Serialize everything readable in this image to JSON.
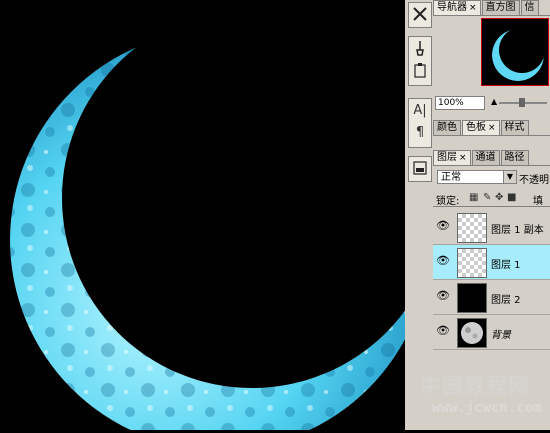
{
  "colors": {
    "canvas_bg": "#000000",
    "moon_light": "#a9f2ff",
    "moon_mid": "#3ac3ea",
    "moon_dark": "#0b6c9a",
    "panel_bg": "#d4d0c8",
    "selected_layer": "#a6ecfb"
  },
  "toolbar": {
    "tools": [
      {
        "icon": "crossed-tools-icon"
      },
      {
        "icon": "brush-presets-icon"
      },
      {
        "icon": "clipboard-icon"
      },
      {
        "icon": "character-icon",
        "glyph": "A|"
      },
      {
        "icon": "paragraph-icon",
        "glyph": "¶"
      },
      {
        "icon": "layer-comps-icon"
      }
    ]
  },
  "panels": {
    "navigator": {
      "tabs": [
        {
          "label": "导航器",
          "close": "×",
          "active": true
        },
        {
          "label": "直方图",
          "active": false
        },
        {
          "label": "信",
          "active": false
        }
      ],
      "zoom": "100%"
    },
    "color": {
      "tabs": [
        {
          "label": "颜色",
          "active": false
        },
        {
          "label": "色板",
          "close": "×",
          "active": true
        },
        {
          "label": "样式",
          "active": false
        }
      ]
    },
    "layers": {
      "tabs": [
        {
          "label": "图层",
          "close": "×",
          "active": true
        },
        {
          "label": "通道",
          "active": false
        },
        {
          "label": "路径",
          "active": false
        }
      ],
      "blend_mode": "正常",
      "opacity_label": "不透明",
      "lock_label": "锁定:",
      "fill_label": "填",
      "items": [
        {
          "name": "图层 1 副本",
          "visible": true,
          "thumb": "checker",
          "selected": false
        },
        {
          "name": "图层 1",
          "visible": true,
          "thumb": "checker",
          "selected": true
        },
        {
          "name": "图层 2",
          "visible": true,
          "thumb": "black",
          "selected": false
        },
        {
          "name": "背景",
          "visible": true,
          "thumb": "moon",
          "selected": false,
          "italic": true
        }
      ]
    }
  },
  "watermark": {
    "text": "中国教程网",
    "url": "www.jcwcn.com"
  }
}
